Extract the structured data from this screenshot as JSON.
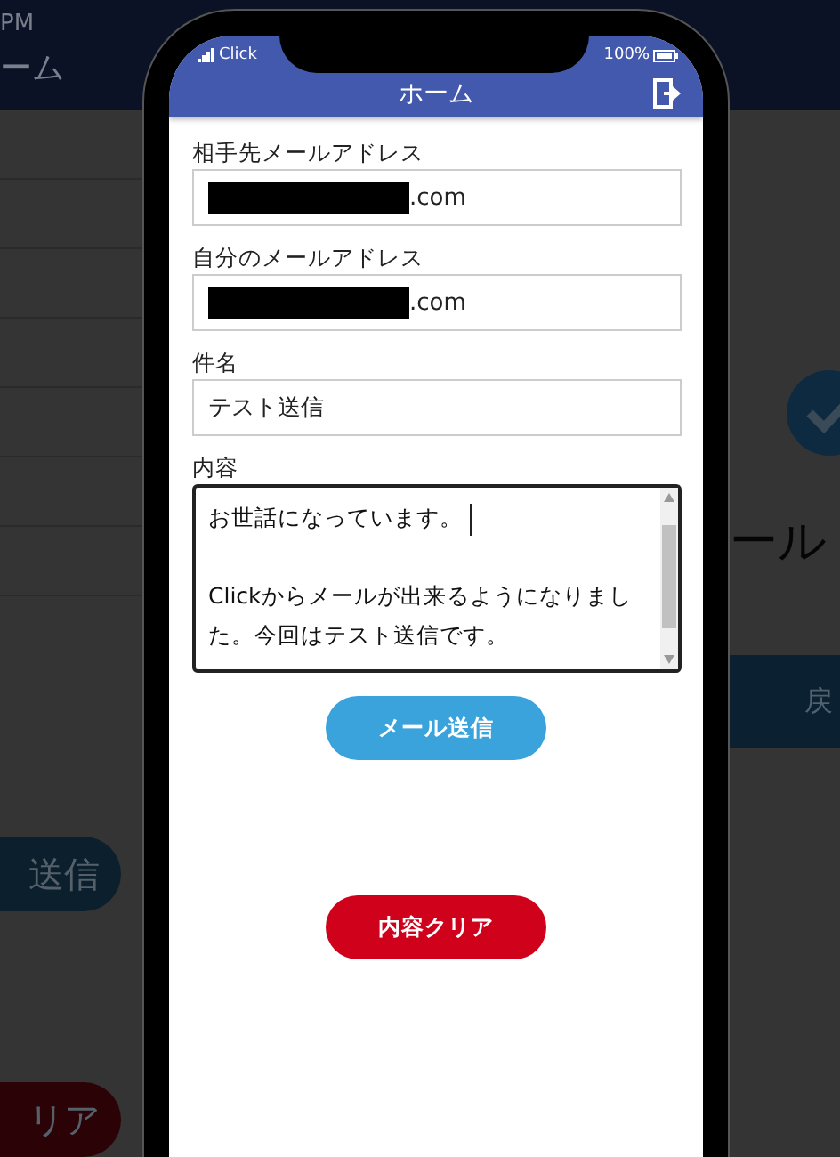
{
  "background": {
    "left": {
      "time": "PM",
      "title": "ーム",
      "send_button": "送信",
      "clear_button": "リア"
    },
    "right": {
      "heading": "ール",
      "back_button": "戻"
    }
  },
  "status_bar": {
    "carrier": "Click",
    "battery": "100%"
  },
  "header": {
    "title": "ホーム"
  },
  "form": {
    "fields": [
      {
        "kind": "input",
        "label": "相手先メールアドレス",
        "value": ".com",
        "redacted": true
      },
      {
        "kind": "input",
        "label": "自分のメールアドレス",
        "value": ".com",
        "redacted": true
      },
      {
        "kind": "input",
        "label": "件名",
        "value": "テスト送信",
        "redacted": false
      },
      {
        "kind": "textarea",
        "label": "内容",
        "paragraphs": [
          "お世話になっています。",
          "Clickからメールが出来るようになりました。今回はテスト送信です。"
        ],
        "focused": true
      }
    ]
  },
  "buttons": [
    {
      "kind": "primary",
      "label": "メール送信"
    },
    {
      "kind": "danger",
      "label": "内容クリア"
    }
  ]
}
